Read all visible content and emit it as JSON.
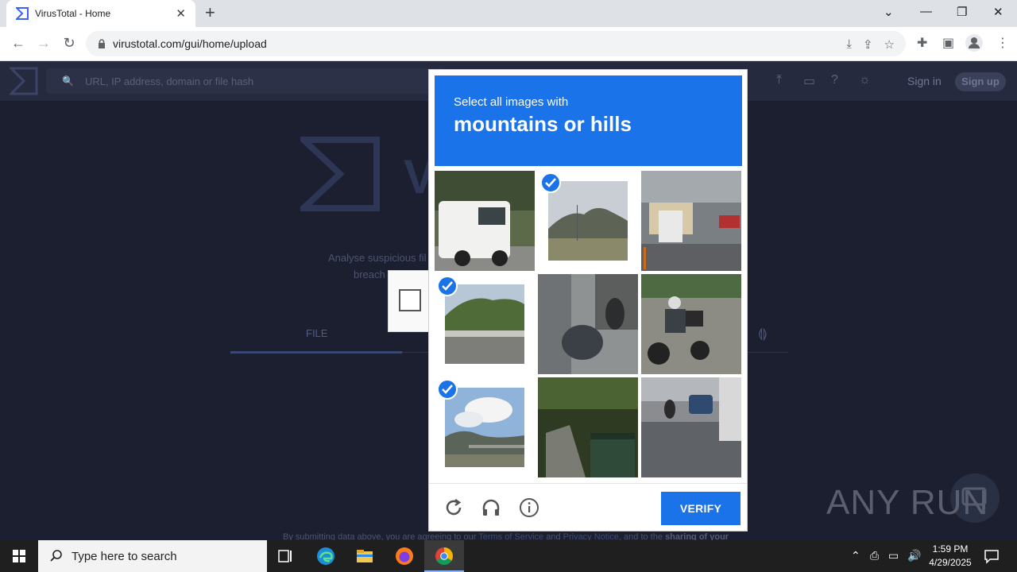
{
  "browser": {
    "tab_title": "VirusTotal - Home",
    "url": "virustotal.com/gui/home/upload"
  },
  "vt": {
    "search_placeholder": "URL, IP address, domain or file hash",
    "sign_in": "Sign in",
    "sign_up": "Sign up",
    "tagline_line1": "Analyse suspicious fil",
    "tagline_line2": "breach",
    "file_tab": "FILE",
    "footer_text1": "By submitting data above, you are agreeing to our ",
    "footer_tos": "Terms of Service",
    "footer_and": " and ",
    "footer_privacy": "Privacy Notice",
    "footer_text2": ", and to the ",
    "footer_bold": "sharing of your"
  },
  "captcha": {
    "prompt_sub": "Select all images with",
    "prompt_main": "mountains or hills",
    "verify_label": "VERIFY",
    "tiles": [
      {
        "index": 0,
        "subject": "white van",
        "selected": false
      },
      {
        "index": 1,
        "subject": "hill",
        "selected": true
      },
      {
        "index": 2,
        "subject": "truck",
        "selected": false
      },
      {
        "index": 3,
        "subject": "green hill",
        "selected": true
      },
      {
        "index": 4,
        "subject": "parked motorbikes",
        "selected": false
      },
      {
        "index": 5,
        "subject": "motorcyclist",
        "selected": false
      },
      {
        "index": 6,
        "subject": "mountain sky",
        "selected": true
      },
      {
        "index": 7,
        "subject": "stairs bin",
        "selected": false
      },
      {
        "index": 8,
        "subject": "wet road",
        "selected": false
      }
    ]
  },
  "watermark": "ANY RUN",
  "taskbar": {
    "search_placeholder": "Type here to search",
    "time": "1:59 PM",
    "date": "4/29/2025"
  }
}
